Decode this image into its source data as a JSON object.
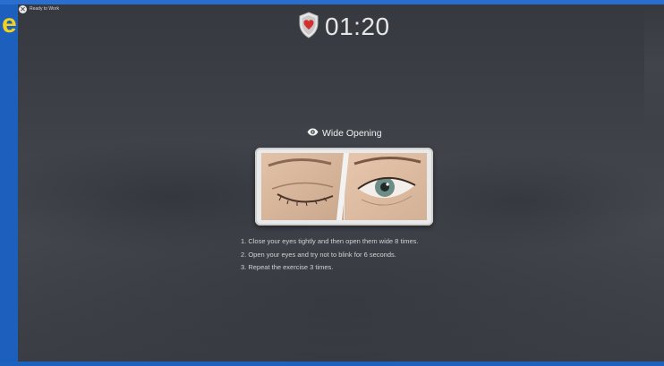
{
  "topbar": {
    "close_icon": "close-x",
    "ready_label": "Ready to Work"
  },
  "timer": {
    "icon": "shield-heart-icon",
    "value": "01:20"
  },
  "exercise": {
    "icon": "eye-icon",
    "title": "Wide Opening",
    "image": "closed-and-open-eye-photo",
    "steps": [
      "1. Close your eyes tightly and then open them wide 8 times.",
      "2. Open your eyes and try not to blink for 6 seconds.",
      "3. Repeat the exercise 3 times."
    ]
  },
  "colors": {
    "frame_blue": "#1a5db8",
    "overlay_bg": "#3e4147",
    "shield_red": "#d32f2f",
    "text": "#e6e6e6"
  }
}
